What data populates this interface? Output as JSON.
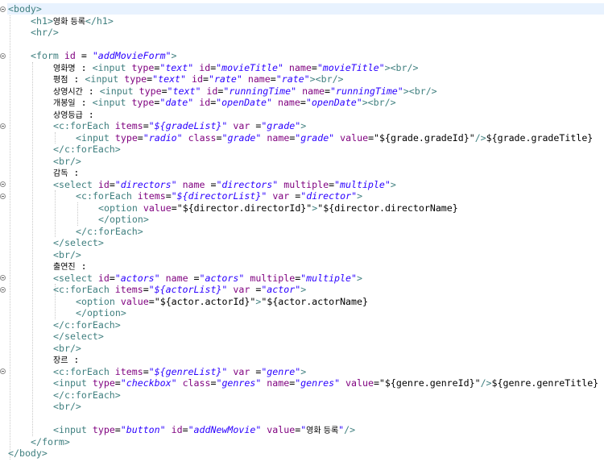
{
  "editor": {
    "lines": [
      {
        "indent": 0,
        "fold": true,
        "hl": true,
        "tokens": [
          [
            "tag",
            "<body>"
          ]
        ]
      },
      {
        "indent": 1,
        "tokens": [
          [
            "tag",
            "<h1>"
          ],
          [
            "kr",
            "영화 등록"
          ],
          [
            "tag",
            "</h1>"
          ]
        ]
      },
      {
        "indent": 1,
        "tokens": [
          [
            "tag",
            "<hr/>"
          ]
        ]
      },
      {
        "indent": 0,
        "tokens": []
      },
      {
        "indent": 1,
        "fold": true,
        "tokens": [
          [
            "tag",
            "<form "
          ],
          [
            "attr",
            "id"
          ],
          [
            "t",
            " = "
          ],
          [
            "val",
            "\"addMovieForm\""
          ],
          [
            "tag",
            ">"
          ]
        ]
      },
      {
        "indent": 2,
        "tokens": [
          [
            "kr",
            "영화명"
          ],
          [
            "t",
            " : "
          ],
          [
            "tag",
            "<input "
          ],
          [
            "attr",
            "type"
          ],
          [
            "t",
            "="
          ],
          [
            "val",
            "\"text\""
          ],
          [
            "t",
            " "
          ],
          [
            "attr",
            "id"
          ],
          [
            "t",
            "="
          ],
          [
            "val",
            "\"movieTitle\""
          ],
          [
            "t",
            " "
          ],
          [
            "attr",
            "name"
          ],
          [
            "t",
            "="
          ],
          [
            "val",
            "\"movieTitle\""
          ],
          [
            "tag",
            ">"
          ],
          [
            "tag",
            "<br/>"
          ]
        ]
      },
      {
        "indent": 2,
        "tokens": [
          [
            "kr",
            "평점"
          ],
          [
            "t",
            " : "
          ],
          [
            "tag",
            "<input "
          ],
          [
            "attr",
            "type"
          ],
          [
            "t",
            "="
          ],
          [
            "val",
            "\"text\""
          ],
          [
            "t",
            " "
          ],
          [
            "attr",
            "id"
          ],
          [
            "t",
            "="
          ],
          [
            "val",
            "\"rate\""
          ],
          [
            "t",
            " "
          ],
          [
            "attr",
            "name"
          ],
          [
            "t",
            "="
          ],
          [
            "val",
            "\"rate\""
          ],
          [
            "tag",
            ">"
          ],
          [
            "tag",
            "<br/>"
          ]
        ]
      },
      {
        "indent": 2,
        "tokens": [
          [
            "kr",
            "상영시간"
          ],
          [
            "t",
            " : "
          ],
          [
            "tag",
            "<input "
          ],
          [
            "attr",
            "type"
          ],
          [
            "t",
            "="
          ],
          [
            "val",
            "\"text\""
          ],
          [
            "t",
            " "
          ],
          [
            "attr",
            "id"
          ],
          [
            "t",
            "="
          ],
          [
            "val",
            "\"runningTime\""
          ],
          [
            "t",
            " "
          ],
          [
            "attr",
            "name"
          ],
          [
            "t",
            "="
          ],
          [
            "val",
            "\"runningTime\""
          ],
          [
            "tag",
            ">"
          ],
          [
            "tag",
            "<br/>"
          ]
        ]
      },
      {
        "indent": 2,
        "tokens": [
          [
            "kr",
            "개봉일"
          ],
          [
            "t",
            " : "
          ],
          [
            "tag",
            "<input "
          ],
          [
            "attr",
            "type"
          ],
          [
            "t",
            "="
          ],
          [
            "val",
            "\"date\""
          ],
          [
            "t",
            " "
          ],
          [
            "attr",
            "id"
          ],
          [
            "t",
            "="
          ],
          [
            "val",
            "\"openDate\""
          ],
          [
            "t",
            " "
          ],
          [
            "attr",
            "name"
          ],
          [
            "t",
            "="
          ],
          [
            "val",
            "\"openDate\""
          ],
          [
            "tag",
            ">"
          ],
          [
            "tag",
            "<br/>"
          ]
        ]
      },
      {
        "indent": 2,
        "tokens": [
          [
            "kr",
            "상영등급"
          ],
          [
            "t",
            " :"
          ]
        ]
      },
      {
        "indent": 2,
        "fold": true,
        "tokens": [
          [
            "tag",
            "<c:forEach "
          ],
          [
            "attr",
            "items"
          ],
          [
            "t",
            "="
          ],
          [
            "val",
            "\"${gradeList}\""
          ],
          [
            "t",
            " "
          ],
          [
            "attr",
            "var"
          ],
          [
            "t",
            " ="
          ],
          [
            "val",
            "\"grade\""
          ],
          [
            "tag",
            ">"
          ]
        ]
      },
      {
        "indent": 3,
        "tokens": [
          [
            "tag",
            "<input "
          ],
          [
            "attr",
            "type"
          ],
          [
            "t",
            "="
          ],
          [
            "val",
            "\"radio\""
          ],
          [
            "t",
            " "
          ],
          [
            "attr",
            "class"
          ],
          [
            "t",
            "="
          ],
          [
            "val",
            "\"grade\""
          ],
          [
            "t",
            " "
          ],
          [
            "attr",
            "name"
          ],
          [
            "t",
            "="
          ],
          [
            "val",
            "\"grade\""
          ],
          [
            "t",
            " "
          ],
          [
            "attr",
            "value"
          ],
          [
            "t",
            "="
          ],
          [
            "t",
            "\"${grade.gradeId}\""
          ],
          [
            "tag",
            "/>"
          ],
          [
            "t",
            "${grade.gradeTitle}"
          ]
        ]
      },
      {
        "indent": 2,
        "tokens": [
          [
            "tag",
            "</c:forEach>"
          ]
        ]
      },
      {
        "indent": 2,
        "tokens": [
          [
            "tag",
            "<br/>"
          ]
        ]
      },
      {
        "indent": 2,
        "tokens": [
          [
            "kr",
            "감독"
          ],
          [
            "t",
            " :"
          ]
        ]
      },
      {
        "indent": 2,
        "fold": true,
        "tokens": [
          [
            "tag",
            "<select "
          ],
          [
            "attr",
            "id"
          ],
          [
            "t",
            "="
          ],
          [
            "val",
            "\"directors\""
          ],
          [
            "t",
            " "
          ],
          [
            "attr",
            "name"
          ],
          [
            "t",
            " ="
          ],
          [
            "val",
            "\"directors\""
          ],
          [
            "t",
            " "
          ],
          [
            "attr",
            "multiple"
          ],
          [
            "t",
            "="
          ],
          [
            "val",
            "\"multiple\""
          ],
          [
            "tag",
            ">"
          ]
        ]
      },
      {
        "indent": 3,
        "fold": true,
        "tokens": [
          [
            "tag",
            "<c:forEach "
          ],
          [
            "attr",
            "items"
          ],
          [
            "t",
            "="
          ],
          [
            "val",
            "\"${directorList}\""
          ],
          [
            "t",
            " "
          ],
          [
            "attr",
            "var"
          ],
          [
            "t",
            " ="
          ],
          [
            "val",
            "\"director\""
          ],
          [
            "tag",
            ">"
          ]
        ]
      },
      {
        "indent": 4,
        "tokens": [
          [
            "tag",
            "<option "
          ],
          [
            "attr",
            "value"
          ],
          [
            "t",
            "="
          ],
          [
            "t",
            "\"${director.directorId}\""
          ],
          [
            "tag",
            ">"
          ],
          [
            "t",
            "\"${director.directorName}"
          ]
        ]
      },
      {
        "indent": 4,
        "tokens": [
          [
            "tag",
            "</option>"
          ]
        ]
      },
      {
        "indent": 3,
        "tokens": [
          [
            "tag",
            "</c:forEach>"
          ]
        ]
      },
      {
        "indent": 2,
        "tokens": [
          [
            "tag",
            "</select>"
          ]
        ]
      },
      {
        "indent": 2,
        "tokens": [
          [
            "tag",
            "<br/>"
          ]
        ]
      },
      {
        "indent": 2,
        "tokens": [
          [
            "kr",
            "출연진"
          ],
          [
            "t",
            " :"
          ]
        ]
      },
      {
        "indent": 2,
        "fold": true,
        "tokens": [
          [
            "tag",
            "<select "
          ],
          [
            "attr",
            "id"
          ],
          [
            "t",
            "="
          ],
          [
            "val",
            "\"actors\""
          ],
          [
            "t",
            " "
          ],
          [
            "attr",
            "name"
          ],
          [
            "t",
            " ="
          ],
          [
            "val",
            "\"actors\""
          ],
          [
            "t",
            " "
          ],
          [
            "attr",
            "multiple"
          ],
          [
            "t",
            "="
          ],
          [
            "val",
            "\"multiple\""
          ],
          [
            "tag",
            ">"
          ]
        ]
      },
      {
        "indent": 2,
        "fold": true,
        "tokens": [
          [
            "tag",
            "<c:forEach "
          ],
          [
            "attr",
            "items"
          ],
          [
            "t",
            "="
          ],
          [
            "val",
            "\"${actorList}\""
          ],
          [
            "t",
            " "
          ],
          [
            "attr",
            "var"
          ],
          [
            "t",
            " ="
          ],
          [
            "val",
            "\"actor\""
          ],
          [
            "tag",
            ">"
          ]
        ]
      },
      {
        "indent": 3,
        "tokens": [
          [
            "tag",
            "<option "
          ],
          [
            "attr",
            "value"
          ],
          [
            "t",
            "="
          ],
          [
            "t",
            "\"${actor.actorId}\""
          ],
          [
            "tag",
            ">"
          ],
          [
            "t",
            "\"${actor.actorName}"
          ]
        ]
      },
      {
        "indent": 3,
        "tokens": [
          [
            "tag",
            "</option>"
          ]
        ]
      },
      {
        "indent": 2,
        "tokens": [
          [
            "tag",
            "</c:forEach>"
          ]
        ]
      },
      {
        "indent": 2,
        "tokens": [
          [
            "tag",
            "</select>"
          ]
        ]
      },
      {
        "indent": 2,
        "tokens": [
          [
            "tag",
            "<br/>"
          ]
        ]
      },
      {
        "indent": 2,
        "tokens": [
          [
            "kr",
            "장르"
          ],
          [
            "t",
            " :"
          ]
        ]
      },
      {
        "indent": 2,
        "fold": true,
        "tokens": [
          [
            "tag",
            "<c:forEach "
          ],
          [
            "attr",
            "items"
          ],
          [
            "t",
            "="
          ],
          [
            "val",
            "\"${genreList}\""
          ],
          [
            "t",
            " "
          ],
          [
            "attr",
            "var"
          ],
          [
            "t",
            " ="
          ],
          [
            "val",
            "\"genre\""
          ],
          [
            "tag",
            ">"
          ]
        ]
      },
      {
        "indent": 2,
        "tokens": [
          [
            "tag",
            "<input "
          ],
          [
            "attr",
            "type"
          ],
          [
            "t",
            "="
          ],
          [
            "val",
            "\"checkbox\""
          ],
          [
            "t",
            " "
          ],
          [
            "attr",
            "class"
          ],
          [
            "t",
            "="
          ],
          [
            "val",
            "\"genres\""
          ],
          [
            "t",
            " "
          ],
          [
            "attr",
            "name"
          ],
          [
            "t",
            "="
          ],
          [
            "val",
            "\"genres\""
          ],
          [
            "t",
            " "
          ],
          [
            "attr",
            "value"
          ],
          [
            "t",
            "="
          ],
          [
            "t",
            "\"${genre.genreId}\""
          ],
          [
            "tag",
            "/>"
          ],
          [
            "t",
            "${genre.genreTitle}"
          ]
        ]
      },
      {
        "indent": 2,
        "tokens": [
          [
            "tag",
            "</c:forEach>"
          ]
        ]
      },
      {
        "indent": 2,
        "tokens": [
          [
            "tag",
            "<br/>"
          ]
        ]
      },
      {
        "indent": 0,
        "tokens": []
      },
      {
        "indent": 2,
        "tokens": [
          [
            "tag",
            "<input "
          ],
          [
            "attr",
            "type"
          ],
          [
            "t",
            "="
          ],
          [
            "val",
            "\"button\""
          ],
          [
            "t",
            " "
          ],
          [
            "attr",
            "id"
          ],
          [
            "t",
            "="
          ],
          [
            "val",
            "\"addNewMovie\""
          ],
          [
            "t",
            " "
          ],
          [
            "attr",
            "value"
          ],
          [
            "t",
            "="
          ],
          [
            "val",
            "\""
          ],
          [
            "kr",
            "영화 등록"
          ],
          [
            "val",
            "\""
          ],
          [
            "tag",
            "/>"
          ]
        ]
      },
      {
        "indent": 1,
        "tokens": [
          [
            "tag",
            "</form>"
          ]
        ]
      },
      {
        "indent": 0,
        "tokens": [
          [
            "tag",
            "</body>"
          ]
        ]
      }
    ]
  }
}
